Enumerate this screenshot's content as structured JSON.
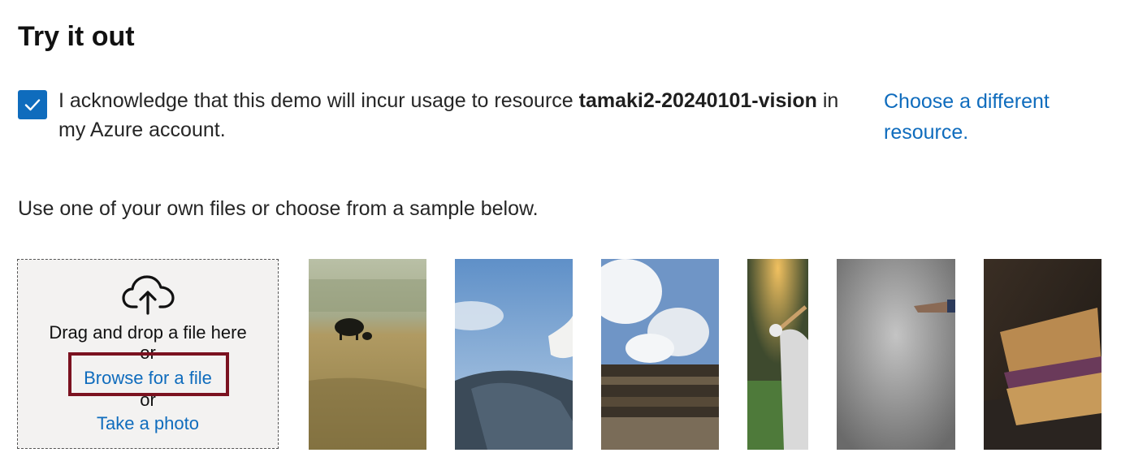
{
  "header": {
    "title": "Try it out"
  },
  "acknowledgement": {
    "checked": true,
    "text_before": "I acknowledge that this demo will incur usage to resource ",
    "resource_name": "tamaki2-20240101-vision",
    "text_after": " in my Azure account.",
    "change_link": "Choose a different resource."
  },
  "instructions": "Use one of your own files or choose from a sample below.",
  "upload": {
    "icon": "cloud-upload-icon",
    "drag_text": "Drag and drop a file here",
    "or_1": "or",
    "browse_link": "Browse for a file",
    "or_2": "or",
    "photo_link": "Take a photo"
  },
  "samples": [
    {
      "name": "cow-in-field",
      "icon": "sample-image"
    },
    {
      "name": "goat-on-rock",
      "icon": "sample-image"
    },
    {
      "name": "building-sky",
      "icon": "sample-image"
    },
    {
      "name": "baseball-batter",
      "icon": "sample-image"
    },
    {
      "name": "person-pointing",
      "icon": "sample-image"
    },
    {
      "name": "sandwich",
      "icon": "sample-image"
    }
  ],
  "colors": {
    "accent": "#0f6cbd",
    "highlight_border": "#7b1220",
    "dropzone_bg": "#f3f2f1"
  }
}
